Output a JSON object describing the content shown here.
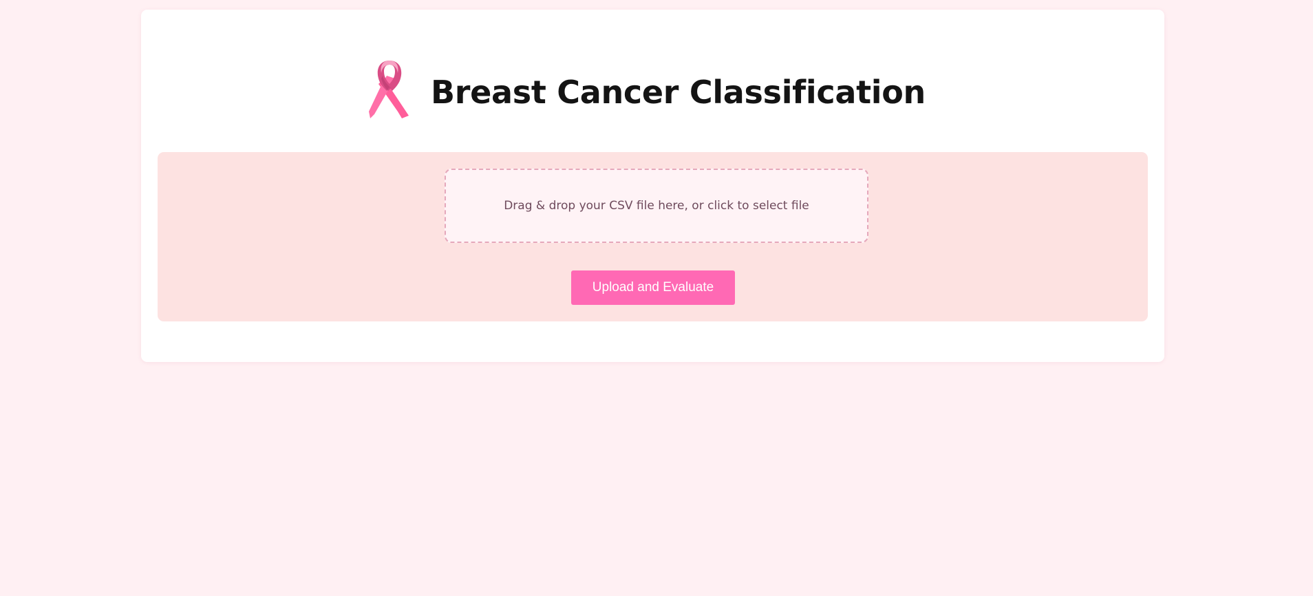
{
  "header": {
    "logo_icon": "pink-ribbon-icon",
    "title": "Breast Cancer Classification"
  },
  "upload": {
    "dropzone_text": "Drag & drop your CSV file here, or click to select file",
    "button_label": "Upload and Evaluate"
  },
  "colors": {
    "page_background": "#fff0f3",
    "panel_background": "#fde2e1",
    "accent": "#ff69b4",
    "dropzone_border": "#e5a8bb",
    "title_text": "#141414"
  }
}
